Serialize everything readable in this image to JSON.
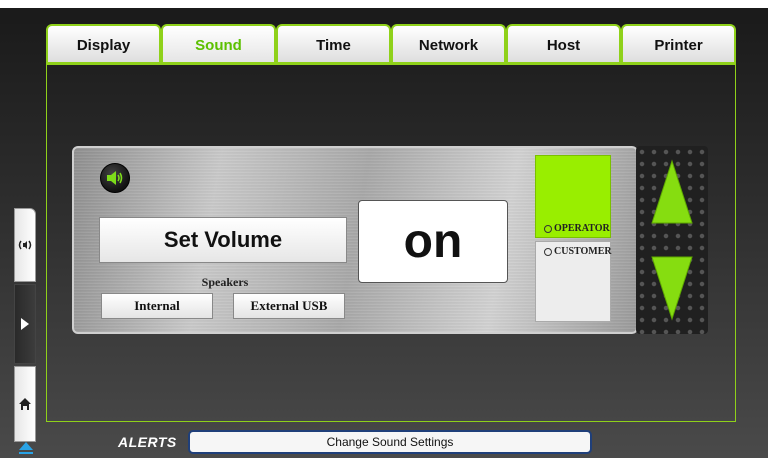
{
  "tabs": [
    {
      "label": "Display",
      "active": false
    },
    {
      "label": "Sound",
      "active": true
    },
    {
      "label": "Time",
      "active": false
    },
    {
      "label": "Network",
      "active": false
    },
    {
      "label": "Host",
      "active": false
    },
    {
      "label": "Printer",
      "active": false
    }
  ],
  "sound_panel": {
    "icon": "speaker-icon",
    "set_volume_label": "Set Volume",
    "current_value": "on",
    "speakers_label": "Speakers",
    "speaker_options": [
      "Internal",
      "External USB"
    ],
    "modes": [
      {
        "label": "OPERATOR",
        "selected": true
      },
      {
        "label": "CUSTOMER",
        "selected": false
      }
    ],
    "up_icon": "arrow-up-icon",
    "down_icon": "arrow-down-icon"
  },
  "side_nav": {
    "icons": [
      "sound-wave-icon",
      "play-icon",
      "home-icon",
      "eject-icon"
    ]
  },
  "alerts": {
    "label": "ALERTS",
    "message": "Change Sound Settings"
  },
  "colors": {
    "accent": "#8fd11a",
    "operator_bg": "#99ee00",
    "alerts_border": "#1f3f7a"
  }
}
